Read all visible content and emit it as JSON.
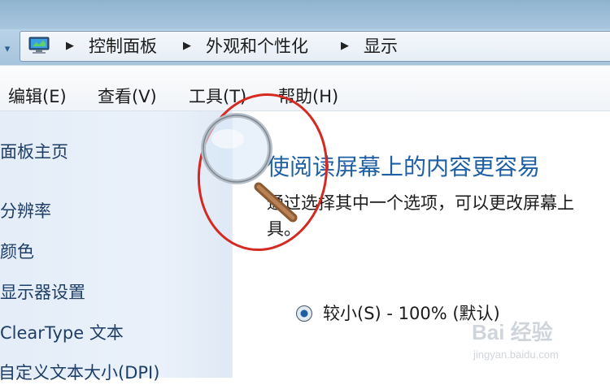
{
  "address_bar": {
    "crumbs": [
      "控制面板",
      "外观和个性化",
      "显示"
    ]
  },
  "menu": {
    "items": [
      "编辑(E)",
      "查看(V)",
      "工具(T)",
      "帮助(H)"
    ]
  },
  "left_nav": {
    "items": [
      "面板主页",
      "分辨率",
      "颜色",
      "显示器设置",
      "ClearType 文本",
      "自定义文本大小(DPI)"
    ]
  },
  "content": {
    "heading": "使阅读屏幕上的内容更容易",
    "description_line1": "通过选择其中一个选项，可以更改屏幕上",
    "description_line2": "具。",
    "option_small_label": "较小(S) - 100% (默认)"
  },
  "annotation": {
    "circle_color": "#d42a22"
  },
  "watermark": {
    "text": "Bai 经验",
    "subtext": "jingyan.baidu.com"
  }
}
